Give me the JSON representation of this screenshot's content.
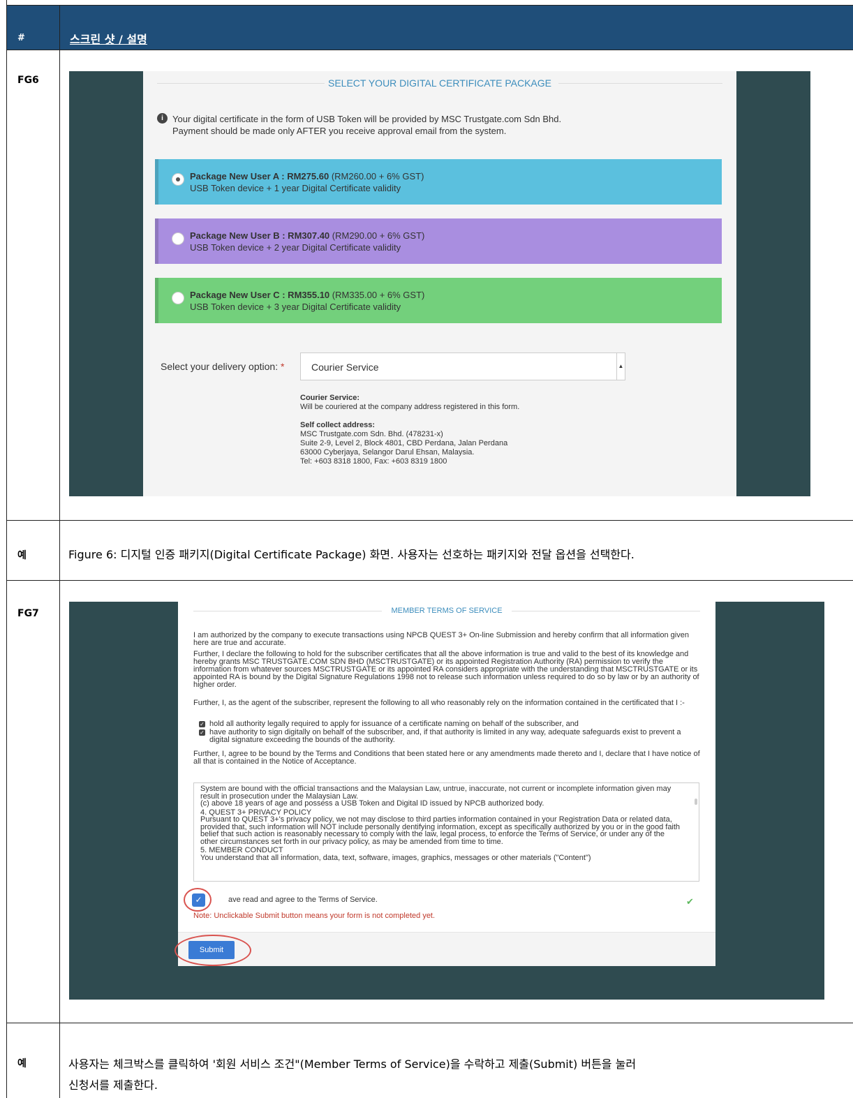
{
  "table": {
    "header_col1": "#",
    "header_col2": "스크린 샷 / 설명"
  },
  "rows": {
    "fg6_label": "FG6",
    "ex1_label": "예",
    "ex1_caption": "Figure 6: 디지털 인증 패키지(Digital Certificate Package) 화면. 사용자는 선호하는 패키지와 전달 옵션을 선택한다.",
    "fg7_label": "FG7",
    "ex2_label": "예",
    "ex2_caption_line1": "사용자는 체크박스를 클릭하여 '회원 서비스 조건\"(Member Terms of Service)을 수락하고 제출(Submit) 버튼을 눌러",
    "ex2_caption_line2": "신청서를 제출한다."
  },
  "fg6": {
    "section_title": "SELECT YOUR DIGITAL CERTIFICATE PACKAGE",
    "info_icon": "info-circle-icon",
    "info_line1": "Your digital certificate in the form of USB Token will be provided by MSC Trustgate.com Sdn Bhd.",
    "info_line2": "Payment should be made only AFTER you receive approval email from the system.",
    "packages": [
      {
        "name": "Package New User A : RM275.60",
        "price_detail": " (RM260.00 + 6% GST)",
        "desc": "USB Token device + 1 year Digital Certificate validity",
        "color": "#5bc0de",
        "selected": true
      },
      {
        "name": "Package New User B : RM307.40",
        "price_detail": " (RM290.00 + 6% GST)",
        "desc": "USB Token device + 2 year Digital Certificate validity",
        "color": "#a98ee0",
        "selected": false
      },
      {
        "name": "Package New User C : RM355.10",
        "price_detail": " (RM335.00 + 6% GST)",
        "desc": "USB Token device + 3 year Digital Certificate validity",
        "color": "#73d07c",
        "selected": false
      }
    ],
    "delivery_label": "Select your delivery option:",
    "required_mark": "*",
    "delivery_value": "Courier Service",
    "courier_title": "Courier Service:",
    "courier_text": "Will be couriered at the company address registered in this form.",
    "self_title": "Self collect address:",
    "self_line1": "MSC Trustgate.com Sdn. Bhd. (478231-x)",
    "self_line2": "Suite 2-9, Level 2, Block 4801, CBD Perdana, Jalan Perdana",
    "self_line3": "63000 Cyberjaya, Selangor Darul Ehsan, Malaysia.",
    "self_line4": "Tel: +603 8318 1800, Fax: +603 8319 1800"
  },
  "fg7": {
    "section_title": "MEMBER TERMS OF SERVICE",
    "para1": "I am authorized by the company to execute transactions using NPCB QUEST 3+ On-line Submission and hereby confirm that all information given here are true and accurate.",
    "para2": "Further, I declare the following to hold for the subscriber certificates that all the above information is true and valid to the best of its knowledge and hereby grants MSC TRUSTGATE.COM SDN BHD (MSCTRUSTGATE) or its appointed Registration Authority (RA) permission to verify the information from whatever sources MSCTRUSTGATE or its appointed RA considers appropriate with the understanding that MSCTRUSTGATE or its appointed RA is bound by the Digital Signature Regulations 1998 not to release such information unless required to do so by law or by an authority of higher order.",
    "para3": "Further, I, as the agent of the subscriber, represent the following to all who reasonably rely on the information contained in the certificated that I :-",
    "check1": "hold all authority legally required to apply for issuance of a certificate naming on behalf of the subscriber, and",
    "check2": "have authority to sign digitally on behalf of the subscriber, and, if that authority is limited in any way, adequate safeguards exist to prevent a digital signature exceeding the bounds of the authority.",
    "para4": "Further, I, agree to be bound by the Terms and Conditions that been stated here or any amendments made thereto and I, declare that I have notice of all that is contained in the Notice of Acceptance.",
    "tos_line1": "System are bound with the official transactions and the Malaysian Law, untrue, inaccurate, not current or incomplete information given may result in prosecution under the Malaysian Law.",
    "tos_line2": "(c) above 18 years of age and possess a USB Token and Digital ID issued by NPCB authorized body.",
    "tos_line3": "4. QUEST 3+ PRIVACY POLICY",
    "tos_line4": "Pursuant to QUEST 3+'s privacy policy, we not may disclose to third parties information contained in your Registration Data or related data, provided that, such information will NOT include personally dentifying information, except as specifically authorized by you or in the good faith belief that such action is reasonably necessary to comply with the law, legal process, to enforce the Terms of Service, or under any of the other circumstances set forth in our privacy policy, as may be amended from time to time.",
    "tos_line5": "5. MEMBER CONDUCT",
    "tos_line6": "You understand that all information, data, text, software, images, graphics, messages or other materials (\"Content\")",
    "agree_text": "ave read and agree to the Terms of Service.",
    "note": "Note: Unclickable Submit button means your form is not completed yet.",
    "submit_label": "Submit"
  }
}
